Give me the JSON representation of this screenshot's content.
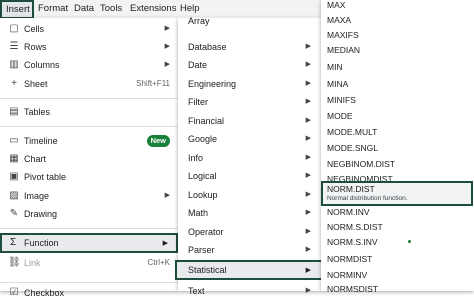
{
  "menubar": {
    "insert": "Insert",
    "format": "Format",
    "data": "Data",
    "tools": "Tools",
    "extensions": "Extensions",
    "help": "Help"
  },
  "insert_menu": {
    "cells": "Cells",
    "rows": "Rows",
    "columns": "Columns",
    "sheet": "Sheet",
    "sheet_shortcut": "Shift+F11",
    "tables": "Tables",
    "timeline": "Timeline",
    "timeline_badge": "New",
    "chart": "Chart",
    "pivot_table": "Pivot table",
    "image": "Image",
    "drawing": "Drawing",
    "function": "Function",
    "link": "Link",
    "link_shortcut": "Ctrl+K",
    "checkbox": "Checkbox"
  },
  "category_menu": {
    "array": "Array",
    "database": "Database",
    "date": "Date",
    "engineering": "Engineering",
    "filter": "Filter",
    "financial": "Financial",
    "google": "Google",
    "info": "Info",
    "logical": "Logical",
    "lookup": "Lookup",
    "math": "Math",
    "operator": "Operator",
    "parser": "Parser",
    "statistical": "Statistical",
    "text": "Text"
  },
  "function_list": {
    "items": [
      "MAX",
      "MAXA",
      "MAXIFS",
      "MEDIAN",
      "MIN",
      "MINA",
      "MINIFS",
      "MODE",
      "MODE.MULT",
      "MODE.SNGL",
      "NEGBINOM.DIST",
      "NEGBINOMDIST"
    ],
    "selected_name": "NORM.DIST",
    "selected_desc": "Normal distribution function.",
    "items_after": [
      "NORM.INV",
      "NORM.S.DIST",
      "NORM.S.INV",
      "NORMDIST",
      "NORMINV",
      "NORMSDIST"
    ]
  },
  "colors": {
    "highlight_border": "#1e4d3c",
    "badge": "#188038"
  }
}
